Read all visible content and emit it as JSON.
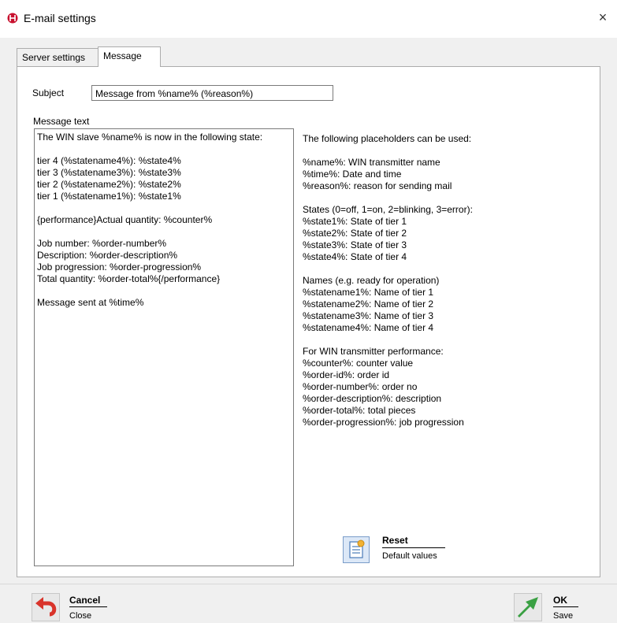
{
  "window": {
    "title": "E-mail settings",
    "close_glyph": "×"
  },
  "tabs": [
    {
      "label": "Server settings",
      "active": false
    },
    {
      "label": "Message",
      "active": true
    }
  ],
  "subject": {
    "label": "Subject",
    "value": "Message from %name% (%reason%)"
  },
  "message": {
    "label": "Message text",
    "lines": [
      "The WIN slave %name% is now in the following state:",
      "",
      "tier 4 (%statename4%): %state4%",
      "tier 3 (%statename3%): %state3%",
      "tier 2 (%statename2%): %state2%",
      "tier 1 (%statename1%): %state1%",
      "",
      "{performance}Actual quantity: %counter%",
      "",
      "Job number: %order-number%",
      "Description: %order-description%",
      "Job progression: %order-progression%",
      "Total quantity: %order-total%{/performance}",
      "",
      "Message sent at %time%"
    ]
  },
  "help": {
    "lines": [
      "The following placeholders can be used:",
      "",
      "%name%: WIN transmitter name",
      "%time%: Date and time",
      "%reason%: reason for sending mail",
      "",
      "States (0=off, 1=on, 2=blinking, 3=error):",
      "%state1%: State of tier 1",
      "%state2%: State of tier 2",
      "%state3%: State of tier 3",
      "%state4%: State of tier 4",
      "",
      "Names (e.g. ready for operation)",
      "%statename1%: Name of tier 1",
      "%statename2%: Name of tier 2",
      "%statename3%: Name of tier 3",
      "%statename4%: Name of tier 4",
      "",
      "For WIN transmitter performance:",
      "%counter%: counter value",
      "%order-id%: order id",
      "%order-number%: order no",
      "%order-description%: description",
      "%order-total%: total pieces",
      "%order-progression%: job progression"
    ]
  },
  "reset_button": {
    "label": "Reset",
    "sub": "Default values"
  },
  "cancel_button": {
    "label": "Cancel",
    "sub": "Close"
  },
  "ok_button": {
    "label": "OK",
    "sub": "Save"
  },
  "colors": {
    "brand_red": "#c8102e",
    "cancel_red": "#d9342b",
    "ok_green": "#3aa043"
  },
  "icons": {
    "app": "app-logo-icon",
    "reset": "document-reset-icon",
    "cancel": "undo-arrow-icon",
    "ok": "check-arrow-icon"
  }
}
